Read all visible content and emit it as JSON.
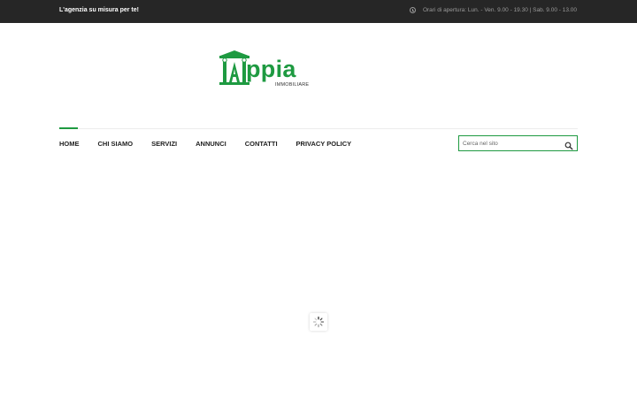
{
  "topbar": {
    "tagline": "L'agenzia su misura per te!",
    "hours": "Orari di apertura:  Lun. - Ven. 9.00 - 19.30 | Sab. 9.00 - 13.00",
    "hours_icon": "clock-icon"
  },
  "logo": {
    "word": "ppia",
    "subtitle": "IMMOBILIARE",
    "color": "#1e9a41"
  },
  "nav": {
    "active_index": 0,
    "items": [
      {
        "label": "HOME"
      },
      {
        "label": "CHI SIAMO"
      },
      {
        "label": "SERVIZI"
      },
      {
        "label": "ANNUNCI"
      },
      {
        "label": "CONTATTI"
      },
      {
        "label": "PRIVACY POLICY"
      }
    ]
  },
  "search": {
    "placeholder": "Cerca nel sito",
    "value": "",
    "icon": "search-icon"
  },
  "loader": {
    "icon": "spinner-icon"
  },
  "colors": {
    "accent": "#1e9a41",
    "topbar_bg": "#262626"
  }
}
